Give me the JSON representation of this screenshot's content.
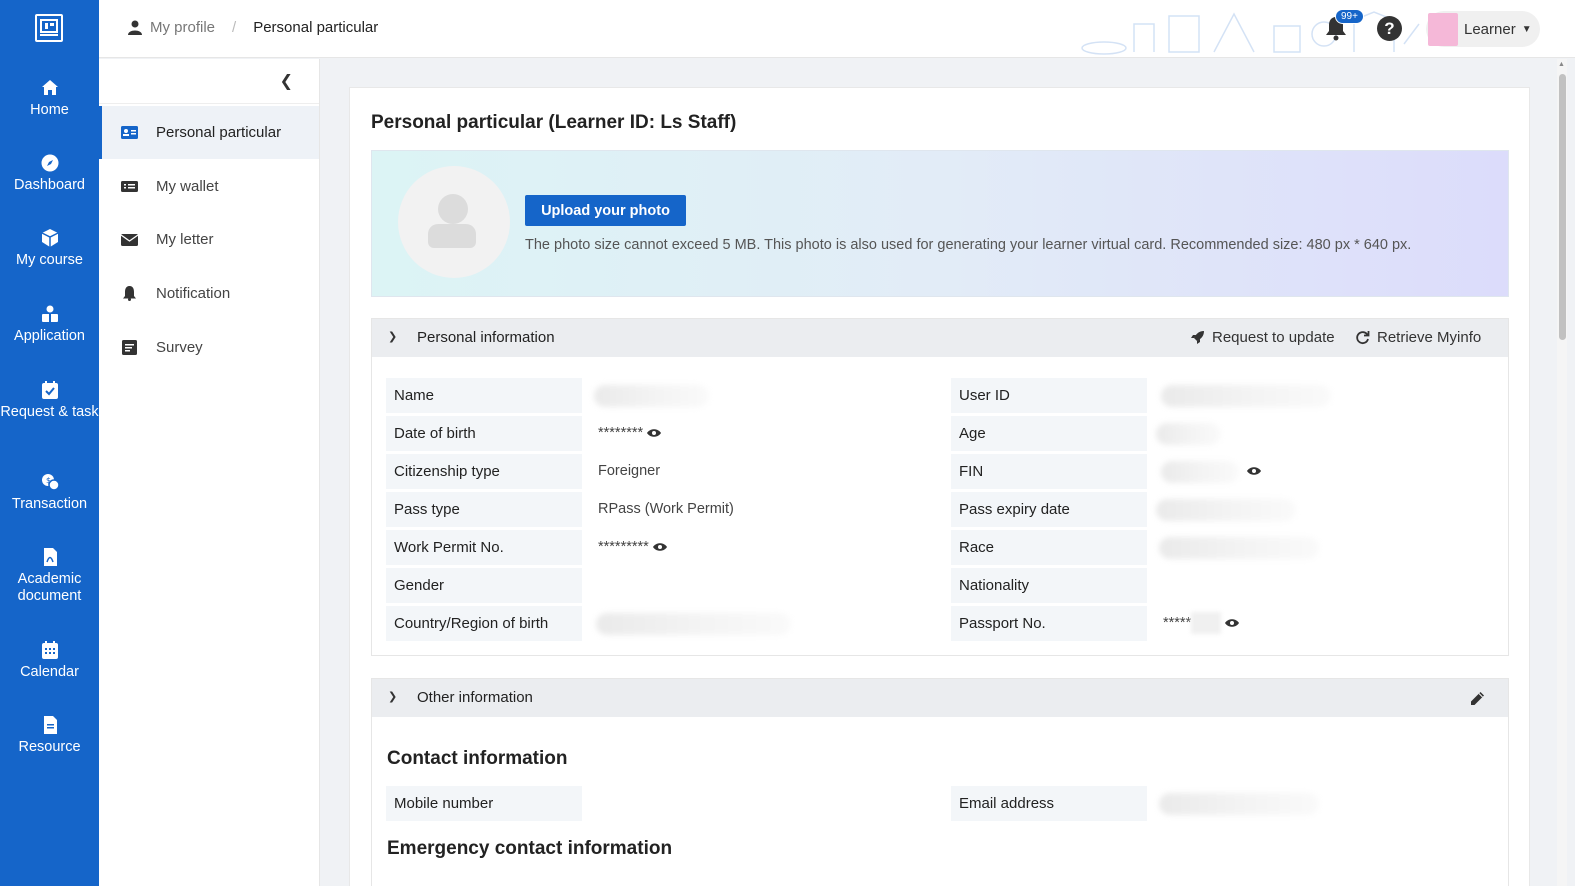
{
  "rail": {
    "items": [
      {
        "label": "Home",
        "icon": "home-icon"
      },
      {
        "label": "Dashboard",
        "icon": "compass-icon"
      },
      {
        "label": "My course",
        "icon": "box-icon"
      },
      {
        "label": "Application",
        "icon": "application-icon"
      },
      {
        "label": "Request & task",
        "icon": "calendar-check-icon"
      },
      {
        "label": "Transaction",
        "icon": "transaction-icon"
      },
      {
        "label": "Academic document",
        "icon": "pdf-icon"
      },
      {
        "label": "Calendar",
        "icon": "calendar-icon"
      },
      {
        "label": "Resource",
        "icon": "file-icon"
      }
    ],
    "color": "#1565c9"
  },
  "header": {
    "breadcrumb_root": "My profile",
    "breadcrumb_sep": "/",
    "breadcrumb_current": "Personal particular",
    "notification_badge": "99+",
    "help_symbol": "?",
    "user_label": "Learner"
  },
  "sub_nav": {
    "items": [
      {
        "label": "Personal particular",
        "icon": "id-card-icon"
      },
      {
        "label": "My wallet",
        "icon": "wallet-icon"
      },
      {
        "label": "My letter",
        "icon": "envelope-icon"
      },
      {
        "label": "Notification",
        "icon": "bell-icon"
      },
      {
        "label": "Survey",
        "icon": "survey-icon"
      }
    ],
    "active_index": 0
  },
  "main": {
    "title": "Personal particular (Learner ID: Ls Staff)",
    "upload_button": "Upload your photo",
    "photo_hint": "The photo size cannot exceed 5 MB. This photo is also used for generating your learner virtual card. Recommended size: 480 px * 640 px.",
    "personal_section": {
      "title": "Personal information",
      "action_request": "Request to update",
      "action_retrieve": "Retrieve Myinfo",
      "left_rows": [
        {
          "label": "Name",
          "value": ""
        },
        {
          "label": "Date of birth",
          "value": "********"
        },
        {
          "label": "Citizenship type",
          "value": "Foreigner"
        },
        {
          "label": "Pass type",
          "value": "RPass (Work Permit)"
        },
        {
          "label": "Work Permit No.",
          "value": "*********"
        },
        {
          "label": "Gender",
          "value": ""
        },
        {
          "label": "Country/Region of birth",
          "value": ""
        }
      ],
      "right_rows": [
        {
          "label": "User ID",
          "value": ""
        },
        {
          "label": "Age",
          "value": ""
        },
        {
          "label": "FIN",
          "value": ""
        },
        {
          "label": "Pass expiry date",
          "value": ""
        },
        {
          "label": "Race",
          "value": ""
        },
        {
          "label": "Nationality",
          "value": ""
        },
        {
          "label": "Passport No.",
          "value": "*****"
        }
      ]
    },
    "other_section": {
      "title": "Other information",
      "contact_heading": "Contact information",
      "mobile_label": "Mobile number",
      "email_label": "Email address",
      "emergency_heading": "Emergency contact information"
    }
  }
}
